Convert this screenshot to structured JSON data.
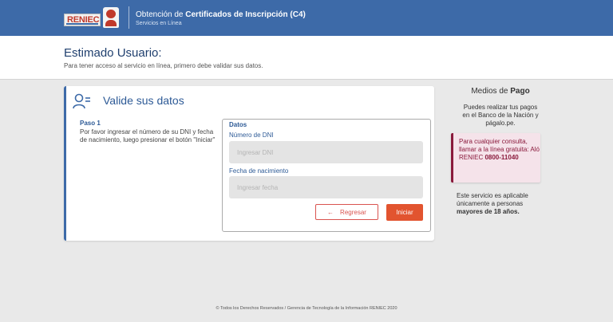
{
  "header": {
    "logo_text": "RENIEC",
    "title_prefix": "Obtención de ",
    "title_bold": "Certificados de Inscripción (C4)",
    "subtitle": "Servicios en Línea"
  },
  "welcome": {
    "heading": "Estimado Usuario:",
    "text": "Para tener acceso al servicio en línea, primero debe validar sus datos."
  },
  "card": {
    "title": "Valide sus datos",
    "step_title": "Paso 1",
    "step_text": "Por favor ingresar el número de su DNI y fecha de nacimiento, luego presionar el botón \"Iniciar\"",
    "form": {
      "section_title": "Datos",
      "dni_label": "Número de DNI",
      "dni_placeholder": "Ingresar DNI",
      "dni_value": "",
      "birth_label": "Fecha de nacimiento",
      "birth_placeholder": "Ingresar fecha",
      "birth_value": "",
      "back_label": "Regresar",
      "start_label": "Iniciar"
    }
  },
  "sidebar": {
    "title_prefix": "Medios de ",
    "title_bold": "Pago",
    "payment_text": "Puedes realizar tus pagos en el Banco de la Nación y págalo.pe.",
    "alert_text": "Para cualquier consulta, llamar a la línea gratuita: Aló RENIEC ",
    "alert_phone": "0800-11040",
    "note_prefix": "Este servicio es aplicable únicamente a personas ",
    "note_bold": "mayores de 18 años."
  },
  "footer": {
    "text": "© Todos los Derechos Reservados / Gerencia de Tecnología de la Información RENIEC 2020"
  },
  "colors": {
    "header_blue": "#3d6aa8",
    "accent_red": "#e2542f",
    "alert_maroon": "#8a1a3c"
  }
}
